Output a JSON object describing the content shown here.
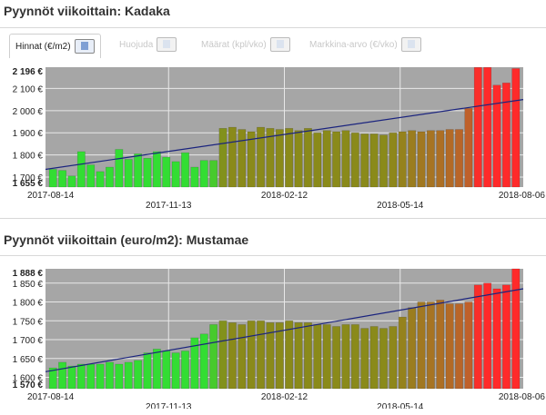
{
  "chart1": {
    "title": "Pyynnöt viikoittain: Kadaka"
  },
  "tabs": [
    {
      "label": "Hinnat (€/m2)",
      "active": true,
      "icon": "chart-export-icon"
    },
    {
      "label": "Huojuda",
      "active": false,
      "icon": "chart-export-icon"
    },
    {
      "label": "Määrat (kpl/vko)",
      "active": false,
      "icon": "chart-export-icon"
    },
    {
      "label": "Markkina-arvo (€/vko)",
      "active": false,
      "icon": "chart-export-icon"
    }
  ],
  "chart2": {
    "title": "Pyynnöt viikoittain (euro/m2): Mustamae"
  },
  "colors": {
    "plot_bg": "#a6a6a6",
    "trend": "#1a237e",
    "green": "#33dd33",
    "olive": "#8a8a1a",
    "orange": "#c0602a",
    "red": "#ff2a2a"
  },
  "chart_data": [
    {
      "type": "bar",
      "title": "Pyynnöt viikoittain: Kadaka",
      "x_ticks": [
        "2017-08-14",
        "2017-11-13",
        "2018-02-12",
        "2018-05-14",
        "2018-08-06"
      ],
      "y_ticks": [
        "1 655 €",
        "1 700 €",
        "1 800 €",
        "1 900 €",
        "2 000 €",
        "2 100 €",
        "2 196 €"
      ],
      "y_tick_values": [
        1655,
        1700,
        1800,
        1900,
        2000,
        2100,
        2196
      ],
      "ylim": [
        1655,
        2196
      ],
      "values": [
        1735,
        1730,
        1705,
        1815,
        1755,
        1725,
        1745,
        1825,
        1780,
        1805,
        1785,
        1815,
        1790,
        1770,
        1810,
        1745,
        1775,
        1775,
        1920,
        1925,
        1915,
        1905,
        1925,
        1920,
        1915,
        1920,
        1910,
        1920,
        1900,
        1910,
        1905,
        1910,
        1900,
        1895,
        1895,
        1890,
        1900,
        1905,
        1910,
        1905,
        1910,
        1910,
        1915,
        1915,
        2010,
        2195,
        2195,
        2115,
        2125,
        2190
      ],
      "trend": [
        1735,
        2050
      ],
      "grid": true
    },
    {
      "type": "bar",
      "title": "Pyynnöt viikoittain (euro/m2): Mustamae",
      "x_ticks": [
        "2017-08-14",
        "2017-11-13",
        "2018-02-12",
        "2018-05-14",
        "2018-08-06"
      ],
      "y_ticks": [
        "1 570 €",
        "1 600 €",
        "1 650 €",
        "1 700 €",
        "1 750 €",
        "1 800 €",
        "1 850 €",
        "1 888 €"
      ],
      "y_tick_values": [
        1570,
        1600,
        1650,
        1700,
        1750,
        1800,
        1850,
        1888
      ],
      "ylim": [
        1570,
        1888
      ],
      "values": [
        1625,
        1640,
        1630,
        1635,
        1635,
        1635,
        1640,
        1635,
        1640,
        1645,
        1665,
        1675,
        1670,
        1665,
        1670,
        1705,
        1715,
        1740,
        1750,
        1745,
        1740,
        1750,
        1750,
        1745,
        1745,
        1750,
        1745,
        1745,
        1740,
        1740,
        1735,
        1740,
        1740,
        1730,
        1735,
        1730,
        1735,
        1760,
        1785,
        1800,
        1800,
        1805,
        1795,
        1795,
        1800,
        1845,
        1850,
        1835,
        1845,
        1888
      ],
      "trend": [
        1615,
        1835
      ],
      "grid": true
    }
  ]
}
